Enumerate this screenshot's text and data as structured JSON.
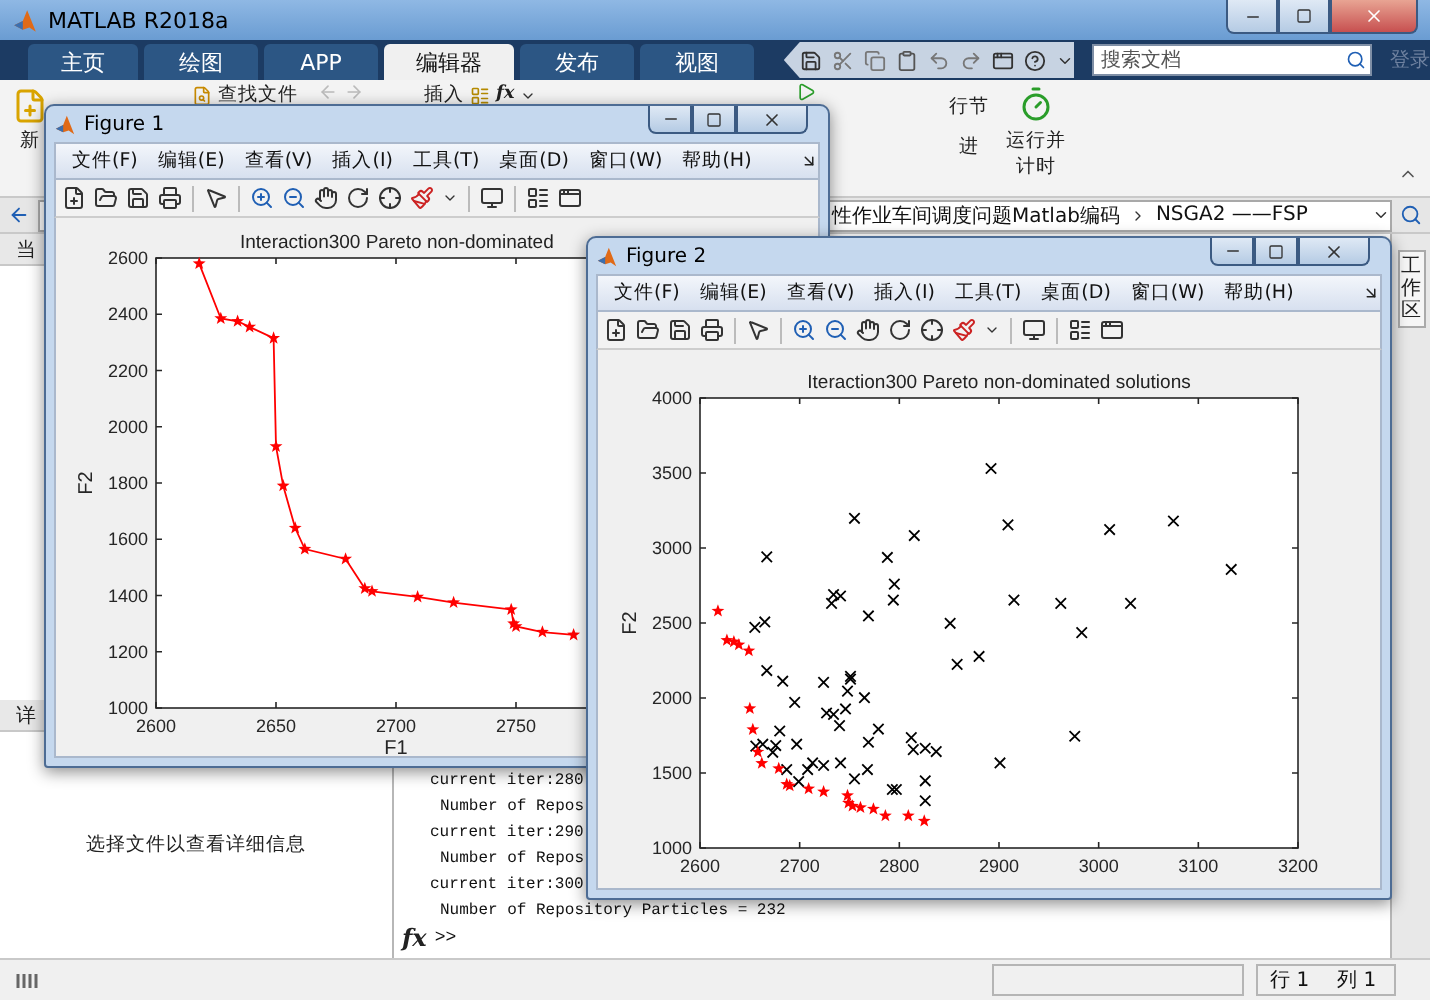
{
  "window": {
    "title": "MATLAB R2018a"
  },
  "tabs": [
    {
      "label": "主页",
      "selected": false
    },
    {
      "label": "绘图",
      "selected": false
    },
    {
      "label": "APP",
      "selected": false
    },
    {
      "label": "编辑器",
      "selected": true
    },
    {
      "label": "发布",
      "selected": false
    },
    {
      "label": "视图",
      "selected": false
    }
  ],
  "search": {
    "placeholder": "搜索文档"
  },
  "sign_in": {
    "label": "登录",
    "disabled": true
  },
  "ribbon": {
    "new_label": "新",
    "find_files": "查找文件",
    "insert": "插入",
    "fx": "fx",
    "section": "行节",
    "advance": "进",
    "run_and_time": "运行并计时"
  },
  "address": {
    "path": "性作业车间调度问题Matlab编码",
    "folder": "NSGA2 ——FSP"
  },
  "panels": {
    "current_folder": "当",
    "details": "详",
    "details_hint": "选择文件以查看详细信息",
    "workspace": "工作区"
  },
  "command_window": {
    "lines": [
      {
        "kind": "iter",
        "text": "current iter:280"
      },
      {
        "kind": "count",
        "text": "Number of Repos"
      },
      {
        "kind": "iter",
        "text": "current iter:290"
      },
      {
        "kind": "count",
        "text": "Number of Repos"
      },
      {
        "kind": "iter",
        "text": "current iter:300"
      },
      {
        "kind": "count",
        "text": "Number of Repository Particles = 232"
      }
    ],
    "fx": "fx",
    "prompt": ">>"
  },
  "status_bar": {
    "row_label": "行",
    "row": "1",
    "col_label": "列",
    "col": "1"
  },
  "figures": [
    {
      "title": "Figure 1",
      "menu": [
        "文件(F)",
        "编辑(E)",
        "查看(V)",
        "插入(I)",
        "工具(T)",
        "桌面(D)",
        "窗口(W)",
        "帮助(H)"
      ],
      "chart_data": {
        "type": "line",
        "title": "Interaction300 Pareto non-dominated",
        "xlabel": "F1",
        "ylabel": "F2",
        "xlim": [
          2600,
          2800
        ],
        "ylim": [
          1000,
          2600
        ],
        "xticks": [
          2600,
          2650,
          2700,
          2750
        ],
        "yticks": [
          1000,
          1200,
          1400,
          1600,
          1800,
          2000,
          2200,
          2400,
          2600
        ],
        "x": [
          2618,
          2627,
          2634,
          2639,
          2649,
          2650,
          2653,
          2658,
          2662,
          2679,
          2687,
          2690,
          2709,
          2724,
          2748,
          2749,
          2750,
          2761,
          2774
        ],
        "series": [
          {
            "color": "#ff0000",
            "marker": "star",
            "values": [
              2580,
              2385,
              2375,
              2355,
              2315,
              1930,
              1790,
              1640,
              1565,
              1530,
              1425,
              1415,
              1395,
              1375,
              1350,
              1300,
              1290,
              1270,
              1260
            ]
          }
        ]
      }
    },
    {
      "title": "Figure 2",
      "menu": [
        "文件(F)",
        "编辑(E)",
        "查看(V)",
        "插入(I)",
        "工具(T)",
        "桌面(D)",
        "窗口(W)",
        "帮助(H)"
      ],
      "chart_data": {
        "type": "scatter",
        "title": "Iteraction300 Pareto non-dominated solutions",
        "ylabel": "F2",
        "xlim": [
          2600,
          3200
        ],
        "ylim": [
          1000,
          4000
        ],
        "xticks": [
          2600,
          2700,
          2800,
          2900,
          3000,
          3100,
          3200
        ],
        "yticks": [
          1000,
          1500,
          2000,
          2500,
          3000,
          3500,
          4000
        ],
        "series": [
          {
            "color": "#000000",
            "marker": "cross",
            "x": [
              2892,
              2755,
              2815,
              2909,
              3011,
              3075,
              3133,
              2667,
              2788,
              2795,
              2794,
              2734,
              2741,
              2732,
              2769,
              2915,
              2962,
              3032,
              2851,
              2983,
              2880,
              2858,
              2665,
              2655,
              2667,
              2683,
              2724,
              2751,
              2751,
              2695,
              2765,
              2748,
              2727,
              2734,
              2746,
              2740,
              2779,
              2769,
              2812,
              2814,
              2826,
              2837,
              2976,
              2901,
              2680,
              2676,
              2673,
              2663,
              2656,
              2697,
              2713,
              2708,
              2724,
              2741,
              2768,
              2755,
              2687,
              2699,
              2793,
              2797,
              2826,
              2826
            ],
            "values": [
              3530,
              3198,
              3083,
              3154,
              3123,
              3180,
              2857,
              2941,
              2937,
              2759,
              2653,
              2689,
              2680,
              2631,
              2547,
              2653,
              2631,
              2631,
              2498,
              2436,
              2277,
              2224,
              2507,
              2471,
              2183,
              2112,
              2104,
              2144,
              2126,
              1971,
              2002,
              2046,
              1900,
              1891,
              1927,
              1816,
              1793,
              1705,
              1736,
              1656,
              1665,
              1643,
              1745,
              1567,
              1780,
              1683,
              1638,
              1692,
              1679,
              1692,
              1567,
              1523,
              1550,
              1567,
              1523,
              1461,
              1523,
              1443,
              1390,
              1390,
              1448,
              1315
            ]
          },
          {
            "color": "#ff0000",
            "marker": "star",
            "x": [
              2618,
              2627,
              2634,
              2639,
              2649,
              2650,
              2653,
              2658,
              2662,
              2679,
              2687,
              2690,
              2709,
              2724,
              2748,
              2749,
              2753,
              2761,
              2774,
              2786,
              2809,
              2825
            ],
            "values": [
              2580,
              2385,
              2375,
              2355,
              2315,
              1930,
              1790,
              1640,
              1565,
              1530,
              1425,
              1415,
              1395,
              1375,
              1350,
              1300,
              1280,
              1270,
              1260,
              1215,
              1215,
              1180
            ]
          }
        ]
      }
    }
  ]
}
